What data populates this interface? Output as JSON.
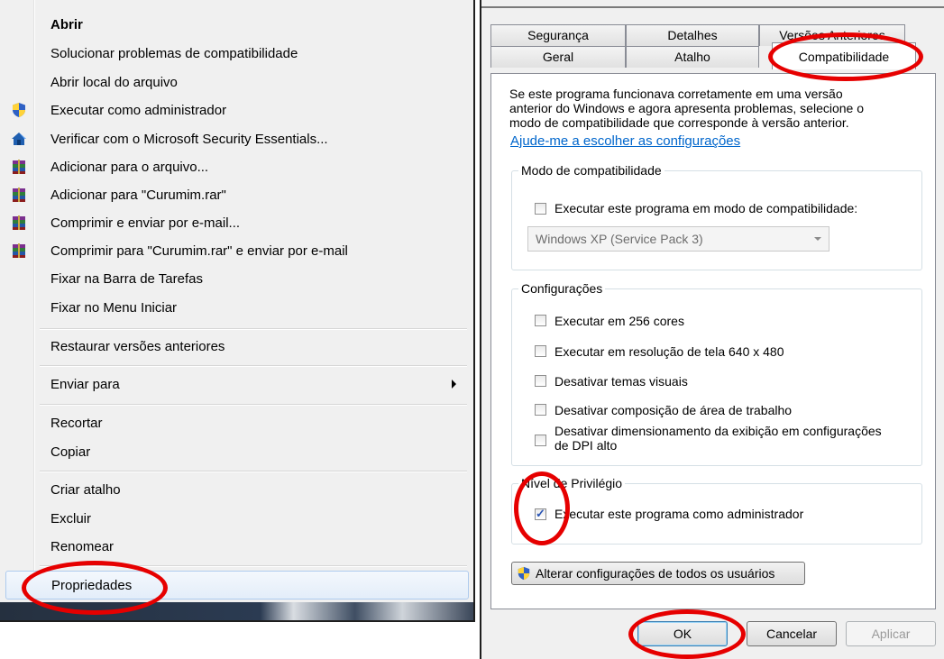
{
  "context_menu": {
    "items": [
      {
        "label": "Abrir",
        "bold": true
      },
      {
        "label": "Solucionar problemas de compatibilidade"
      },
      {
        "label": "Abrir local do arquivo"
      },
      {
        "label": "Executar como administrador",
        "icon": "uac-shield-icon"
      },
      {
        "label": "Verificar com o Microsoft Security Essentials...",
        "icon": "security-essentials-icon"
      },
      {
        "label": "Adicionar para o arquivo...",
        "icon": "winrar-icon"
      },
      {
        "label": "Adicionar para \"Curumim.rar\"",
        "icon": "winrar-icon"
      },
      {
        "label": "Comprimir e enviar por e-mail...",
        "icon": "winrar-icon"
      },
      {
        "label": "Comprimir para \"Curumim.rar\" e enviar por e-mail",
        "icon": "winrar-icon"
      },
      {
        "label": "Fixar na Barra de Tarefas"
      },
      {
        "label": "Fixar no Menu Iniciar"
      },
      {
        "label": "Restaurar versões anteriores"
      },
      {
        "label": "Enviar para",
        "submenu": true
      },
      {
        "label": "Recortar"
      },
      {
        "label": "Copiar"
      },
      {
        "label": "Criar atalho"
      },
      {
        "label": "Excluir"
      },
      {
        "label": "Renomear"
      },
      {
        "label": "Propriedades",
        "highlighted": true
      }
    ]
  },
  "dialog": {
    "tabs_back": [
      "Segurança",
      "Detalhes",
      "Versões Anteriores"
    ],
    "tabs_front": [
      "Geral",
      "Atalho",
      "Compatibilidade"
    ],
    "active_tab": "Compatibilidade",
    "intro_lines": [
      "Se este programa funcionava corretamente em uma versão",
      "anterior do Windows e agora apresenta problemas, selecione o",
      "modo de compatibilidade que corresponde à versão anterior."
    ],
    "help_link": "Ajude-me a escolher as configurações",
    "compat_group": {
      "title": "Modo de compatibilidade",
      "checkbox_label": "Executar este programa em modo de compatibilidade:",
      "checked": false,
      "combo_value": "Windows XP (Service Pack 3)"
    },
    "settings_group": {
      "title": "Configurações",
      "options": [
        {
          "label": "Executar em 256 cores",
          "checked": false
        },
        {
          "label": "Executar em resolução de tela 640 x 480",
          "checked": false
        },
        {
          "label": "Desativar temas visuais",
          "checked": false
        },
        {
          "label": "Desativar composição de área de trabalho",
          "checked": false
        },
        {
          "label": "Desativar dimensionamento da exibição em configurações",
          "label2": "de DPI alto",
          "checked": false
        }
      ]
    },
    "privilege_group": {
      "title": "Nível de Privilégio",
      "checkbox_label": "Executar este programa como administrador",
      "checked": true
    },
    "all_users_button": "Alterar configurações de todos os usuários",
    "buttons": {
      "ok": "OK",
      "cancel": "Cancelar",
      "apply": "Aplicar"
    },
    "annotation_color": "#e60000"
  }
}
